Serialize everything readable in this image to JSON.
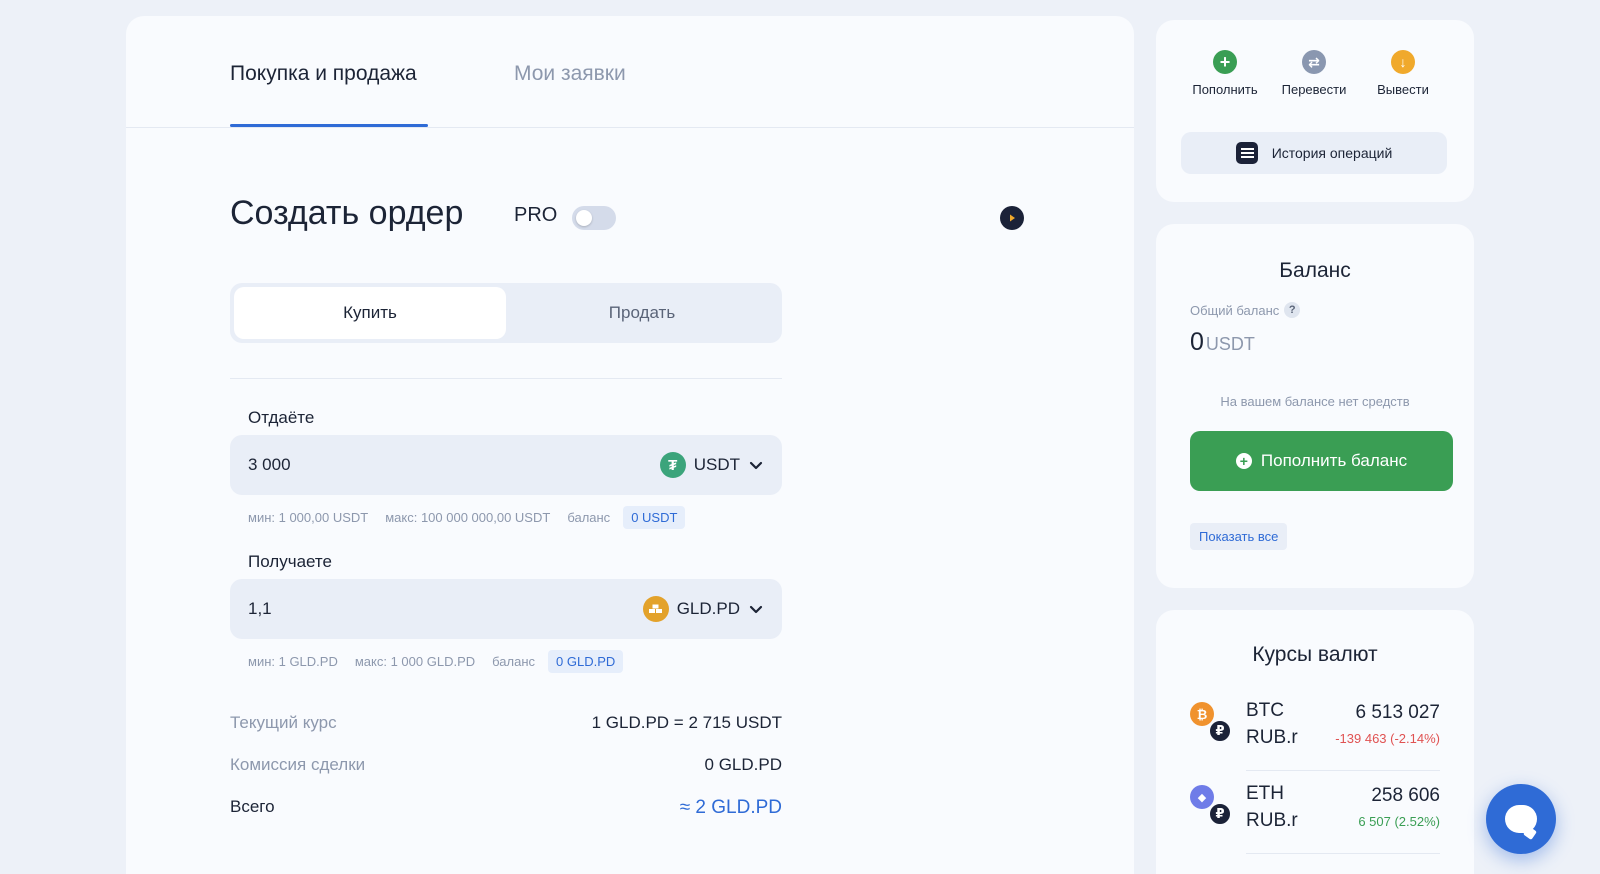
{
  "tabs": [
    {
      "label": "Покупка и продажа",
      "active": true
    },
    {
      "label": "Мои заявки",
      "active": false
    }
  ],
  "order": {
    "title": "Создать ордер",
    "pro_label": "PRO",
    "pro_enabled": false,
    "mode_buttons": [
      {
        "label": "Купить",
        "active": true
      },
      {
        "label": "Продать",
        "active": false
      }
    ]
  },
  "give": {
    "label": "Отдаёте",
    "value": "3 000",
    "currency": "USDT",
    "currency_icon": "tether-icon",
    "min": "мин: 1 000,00 USDT",
    "max": "макс: 100 000 000,00 USDT",
    "balance_label": "баланс",
    "balance": "0 USDT"
  },
  "receive": {
    "label": "Получаете",
    "value": "1,1",
    "currency": "GLD.PD",
    "currency_icon": "gold-bars-icon",
    "min": "мин: 1 GLD.PD",
    "max": "макс: 1 000 GLD.PD",
    "balance_label": "баланс",
    "balance": "0 GLD.PD"
  },
  "summary": {
    "rate_label": "Текущий курс",
    "rate_value": "1 GLD.PD = 2 715 USDT",
    "fee_label": "Комиссия сделки",
    "fee_value": "0 GLD.PD",
    "total_label": "Всего",
    "total_value": "≈ 2 GLD.PD"
  },
  "actions": {
    "items": [
      {
        "label": "Пополнить",
        "icon": "plus-icon",
        "color": "#3a9e54",
        "glyph": "+"
      },
      {
        "label": "Перевести",
        "icon": "transfer-icon",
        "color": "#8a97b0",
        "glyph": "⇄"
      },
      {
        "label": "Вывести",
        "icon": "withdraw-icon",
        "color": "#f0a92c",
        "glyph": "↓"
      }
    ],
    "history_label": "История операций"
  },
  "balance": {
    "title": "Баланс",
    "total_label": "Общий баланс",
    "help_glyph": "?",
    "amount": "0",
    "currency": "USDT",
    "empty_text": "На вашем балансе нет средств",
    "topup_label": "Пополнить баланс",
    "show_all_label": "Показать все"
  },
  "rates": {
    "title": "Курсы валют",
    "items": [
      {
        "base": "BTC",
        "quote": "RUB.r",
        "price": "6 513 027",
        "change": "-139 463 (-2.14%)",
        "direction": "down",
        "icon": "bitcoin-icon",
        "color": "#f0922e",
        "glyph": "₿"
      },
      {
        "base": "ETH",
        "quote": "RUB.r",
        "price": "258 606",
        "change": "6 507 (2.52%)",
        "direction": "up",
        "icon": "ethereum-icon",
        "color": "#6f7ce8",
        "glyph": "◆"
      }
    ]
  },
  "colors": {
    "accent": "#2f6bd6",
    "success": "#3a9e54",
    "danger": "#e05252"
  }
}
